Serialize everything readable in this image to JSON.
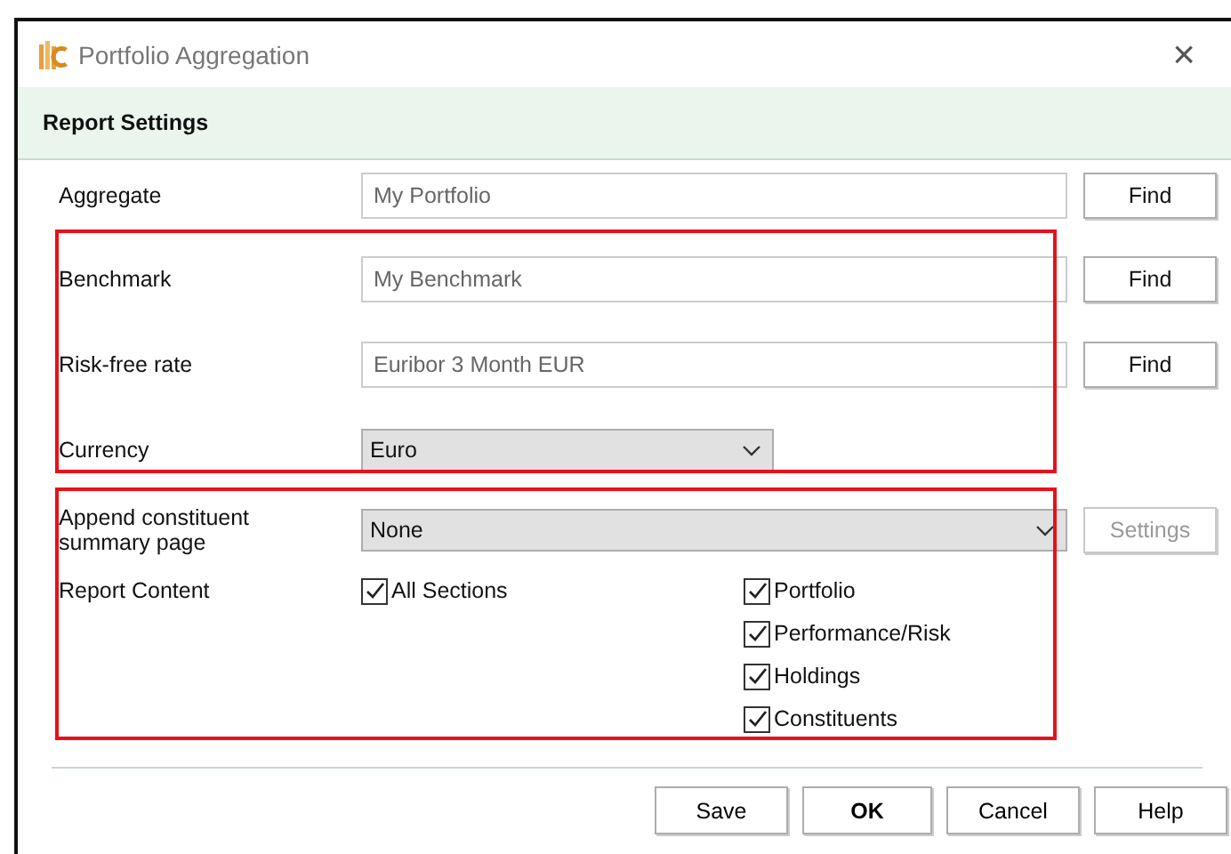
{
  "window": {
    "title": "Portfolio Aggregation",
    "close": "×"
  },
  "header": "Report Settings",
  "sections": [
    {
      "highlighted": false,
      "rows": [
        {
          "kind": "text",
          "label": "Aggregate",
          "value": "My Portfolio",
          "button": "Find"
        }
      ]
    },
    {
      "highlighted": true,
      "rows": [
        {
          "kind": "text",
          "label": "Benchmark",
          "value": "My Benchmark",
          "button": "Find"
        },
        {
          "kind": "text",
          "label": "Risk-free rate",
          "value": "Euribor 3 Month EUR",
          "button": "Find"
        },
        {
          "kind": "select",
          "label": "Currency",
          "value": "Euro",
          "wide": false
        }
      ]
    },
    {
      "highlighted": true,
      "rows": [
        {
          "kind": "select",
          "label": "Append constituent summary page",
          "value": "None",
          "wide": true,
          "button": "Settings",
          "button_disabled": true
        },
        {
          "kind": "checks",
          "label": "Report Content",
          "columns": [
            [
              {
                "label": "All Sections",
                "checked": true
              }
            ],
            [
              {
                "label": "Portfolio",
                "checked": true
              },
              {
                "label": "Performance/Risk",
                "checked": true
              },
              {
                "label": "Holdings",
                "checked": true
              },
              {
                "label": "Constituents",
                "checked": true
              }
            ]
          ]
        }
      ]
    }
  ],
  "buttons": [
    {
      "label": "Save",
      "default": false
    },
    {
      "label": "OK",
      "default": true
    },
    {
      "label": "Cancel",
      "default": false
    },
    {
      "label": "Help",
      "default": false
    }
  ]
}
